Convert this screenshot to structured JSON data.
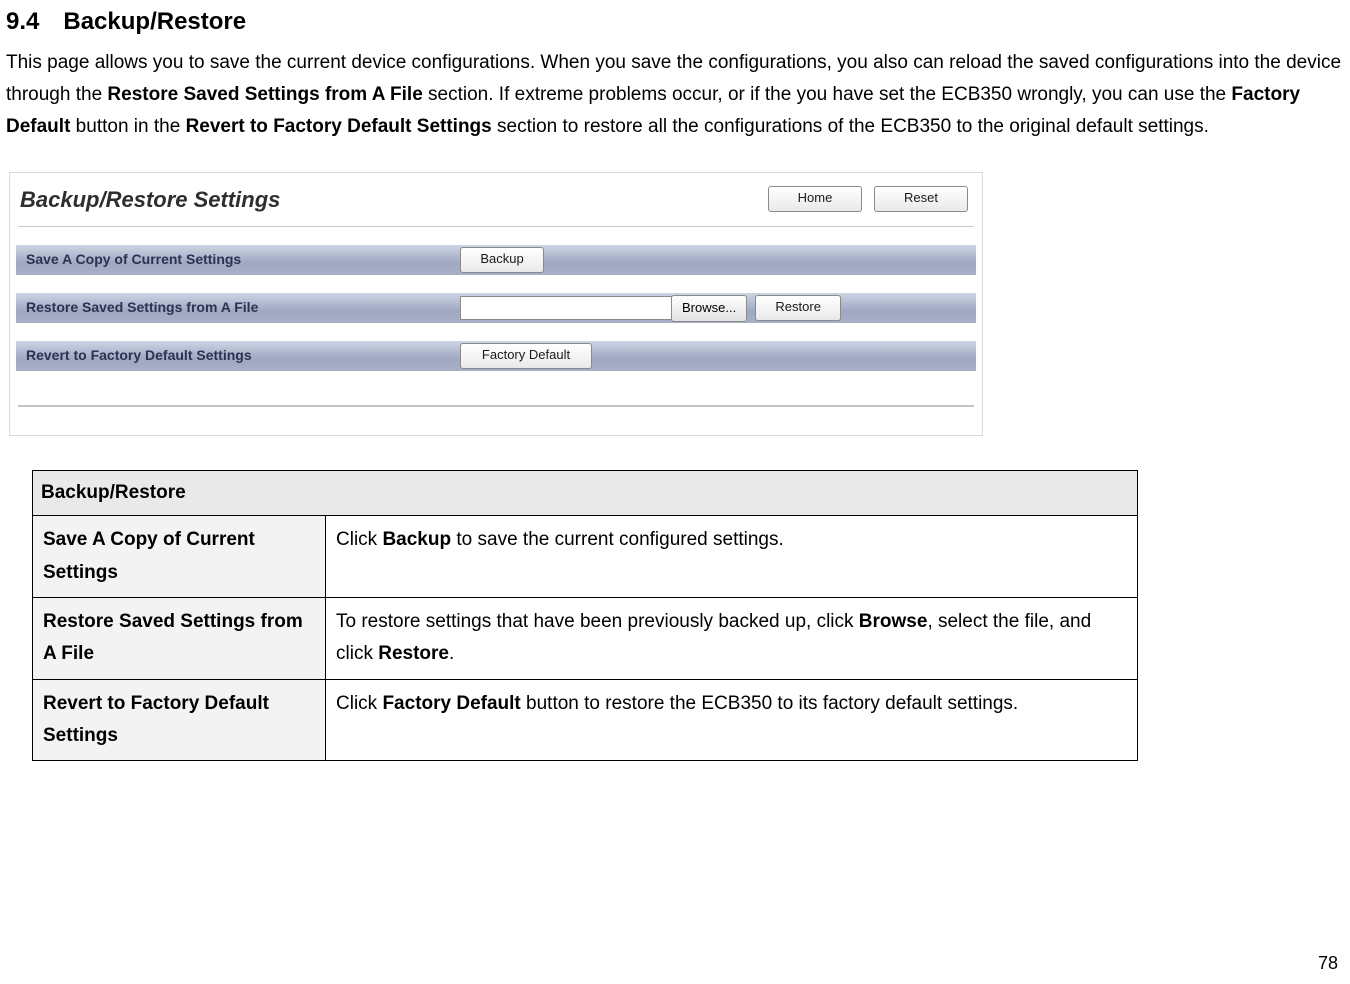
{
  "heading": {
    "num": "9.4",
    "title": "Backup/Restore"
  },
  "intro": {
    "p1a": "This page allows you to save the current device configurations. When you save the configurations, you also can reload the saved configurations into the device through the ",
    "b1": "Restore Saved Settings from A File",
    "p1b": " section. If extreme problems occur, or if the you have set the ECB350 wrongly, you can use the ",
    "b2": "Factory Default",
    "p1c": " button in the ",
    "b3": "Revert to Factory Default Settings",
    "p1d": " section to restore all the configurations of the ECB350 to the original default settings."
  },
  "screenshot": {
    "title": "Backup/Restore Settings",
    "home": "Home",
    "reset": "Reset",
    "row1_label": "Save A Copy of Current Settings",
    "row1_btn": "Backup",
    "row2_label": "Restore  Saved  Settings from A File",
    "row2_browse": "Browse...",
    "row2_restore": "Restore",
    "row3_label": "Revert to Factory Default Settings",
    "row3_btn": "Factory Default"
  },
  "table": {
    "header": "Backup/Restore",
    "r1c1": "Save A Copy of Current Settings",
    "r1c2a": "Click ",
    "r1c2b": "Backup",
    "r1c2c": " to save the current configured settings.",
    "r2c1": "Restore Saved Settings from A File",
    "r2c2a": "To restore settings that have been previously backed up, click ",
    "r2c2b": "Browse",
    "r2c2c": ", select the file, and click ",
    "r2c2d": "Restore",
    "r2c2e": ".",
    "r3c1": "Revert to Factory Default Settings",
    "r3c2a": "Click ",
    "r3c2b": "Factory Default",
    "r3c2c": " button to restore the ECB350 to its factory default settings."
  },
  "pagenum": "78"
}
